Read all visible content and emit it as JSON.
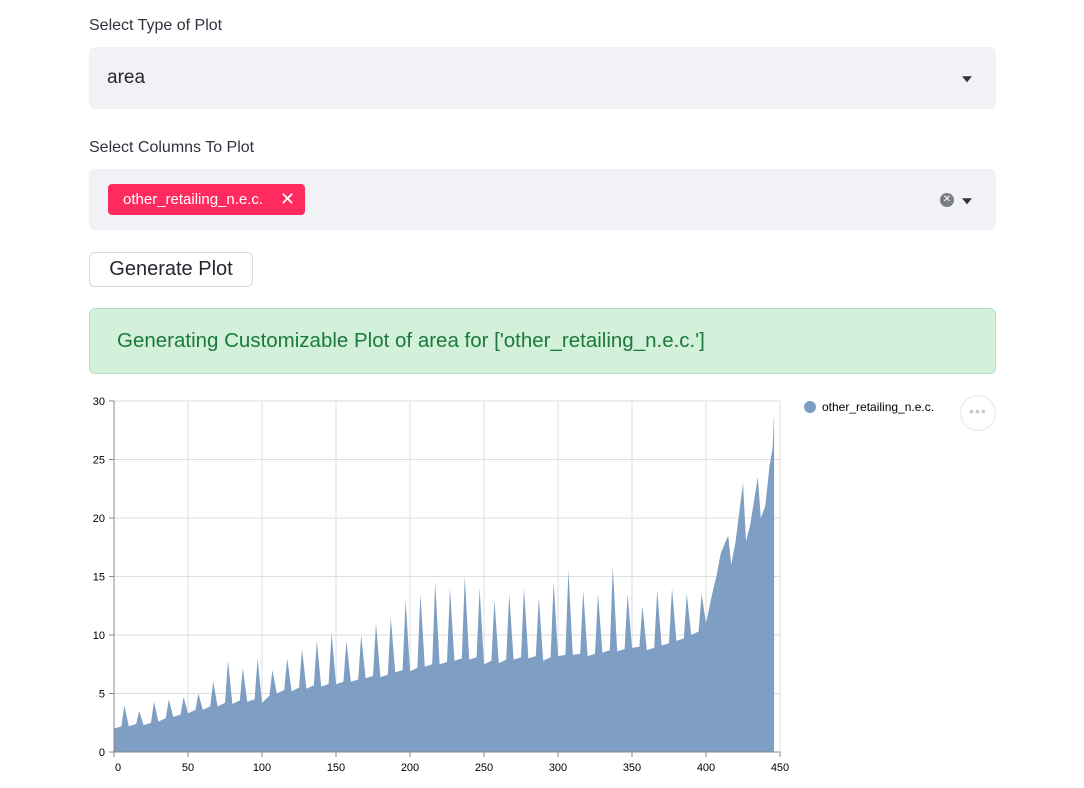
{
  "plot_type": {
    "label": "Select Type of Plot",
    "value": "area"
  },
  "columns": {
    "label": "Select Columns To Plot",
    "selected": [
      "other_retailing_n.e.c."
    ]
  },
  "generate_button": {
    "label": "Generate Plot"
  },
  "alert": {
    "text": "Generating Customizable Plot of area for ['other_retailing_n.e.c.']"
  },
  "icons": {
    "dropdown": "chevron-down-icon",
    "clear": "clear-icon",
    "remove": "close-icon",
    "menu": "more-horizontal-icon"
  },
  "colors": {
    "series": "#7f9ec3",
    "chip": "#ff2b5f",
    "success_bg": "#d3f0da",
    "success_text": "#1a7a3a"
  },
  "chart_data": {
    "type": "area",
    "title": "",
    "xlabel": "",
    "ylabel": "",
    "xlim": [
      0,
      450
    ],
    "ylim": [
      0,
      30
    ],
    "xticks": [
      0,
      50,
      100,
      150,
      200,
      250,
      300,
      350,
      400,
      450
    ],
    "yticks": [
      0,
      5,
      10,
      15,
      20,
      25,
      30
    ],
    "grid": true,
    "legend": "top-right",
    "series": [
      {
        "name": "other_retailing_n.e.c.",
        "color": "#7f9ec3",
        "x": [
          0,
          5,
          7,
          10,
          15,
          17,
          20,
          25,
          27,
          30,
          35,
          37,
          40,
          45,
          47,
          50,
          55,
          57,
          60,
          65,
          67,
          70,
          75,
          77,
          80,
          85,
          87,
          90,
          95,
          97,
          100,
          105,
          107,
          110,
          115,
          117,
          120,
          125,
          127,
          130,
          135,
          137,
          140,
          145,
          147,
          150,
          155,
          157,
          160,
          165,
          167,
          170,
          175,
          177,
          180,
          185,
          187,
          190,
          195,
          197,
          200,
          205,
          207,
          210,
          215,
          217,
          220,
          225,
          227,
          230,
          235,
          237,
          240,
          245,
          247,
          250,
          255,
          257,
          260,
          265,
          267,
          270,
          275,
          277,
          280,
          285,
          287,
          290,
          295,
          297,
          300,
          305,
          307,
          310,
          315,
          317,
          320,
          325,
          327,
          330,
          335,
          337,
          340,
          345,
          347,
          350,
          355,
          357,
          360,
          365,
          367,
          370,
          375,
          377,
          380,
          385,
          387,
          390,
          395,
          397,
          400,
          405,
          407,
          410,
          415,
          417,
          420,
          425,
          427,
          430,
          435,
          437,
          440,
          443,
          445,
          446
        ],
        "values": [
          2,
          2.2,
          4,
          2.2,
          2.4,
          3.5,
          2.3,
          2.5,
          4.3,
          2.6,
          2.9,
          4.5,
          3,
          3.2,
          4.7,
          3.3,
          3.6,
          5,
          3.6,
          3.9,
          6,
          3.9,
          4.2,
          7.8,
          4.1,
          4.4,
          7.2,
          4.3,
          4.5,
          8,
          4.2,
          4.8,
          7,
          5,
          5.3,
          8,
          5.2,
          5.5,
          8.8,
          5.4,
          5.7,
          9.5,
          5.6,
          5.8,
          10.2,
          5.8,
          6,
          9.5,
          6,
          6.2,
          10,
          6.3,
          6.5,
          11,
          6.4,
          6.6,
          11.5,
          6.8,
          7,
          13,
          6.9,
          7.2,
          13.5,
          7.3,
          7.5,
          14.5,
          7.5,
          7.7,
          14,
          7.8,
          8,
          15,
          7.9,
          8.1,
          14,
          7.5,
          7.8,
          13,
          7.6,
          7.9,
          13.5,
          7.9,
          8.1,
          14,
          8,
          8.2,
          13.2,
          7.8,
          8.1,
          14.5,
          8.2,
          8.3,
          15.5,
          8.3,
          8.4,
          13.8,
          8.2,
          8.4,
          13.5,
          8.5,
          8.7,
          15.8,
          8.6,
          8.8,
          13.5,
          8.9,
          9,
          12.5,
          8.7,
          8.9,
          13.8,
          9.1,
          9.3,
          14,
          9.5,
          9.7,
          13.5,
          10,
          10.3,
          13.5,
          11,
          14,
          15,
          17,
          18.5,
          16,
          18,
          23,
          18,
          19.5,
          23.5,
          20,
          21,
          24.5,
          26,
          29
        ]
      }
    ]
  }
}
